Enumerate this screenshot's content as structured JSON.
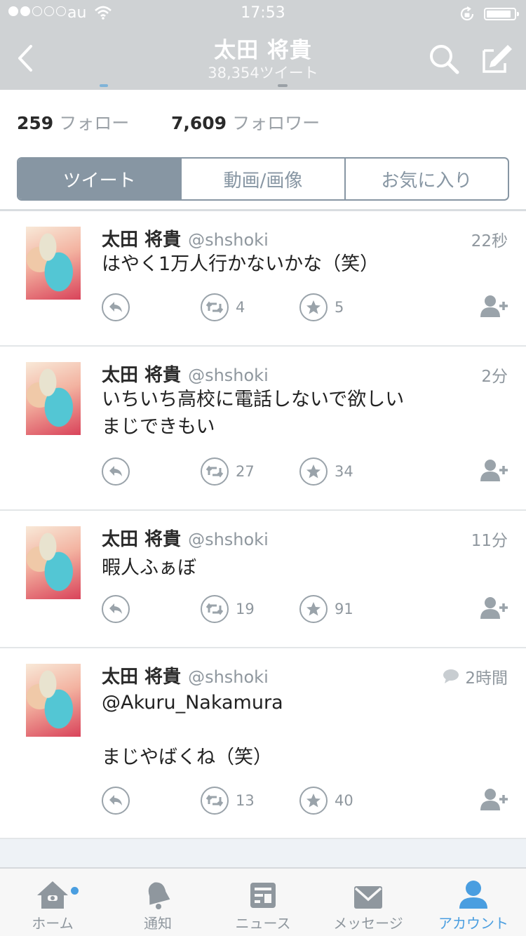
{
  "status_bar": {
    "carrier": "au",
    "time": "17:53"
  },
  "nav": {
    "title": "太田 将貴",
    "subtitle": "38,354ツイート"
  },
  "stats": {
    "following_count": "259",
    "following_label": "フォロー",
    "followers_count": "7,609",
    "followers_label": "フォロワー"
  },
  "segments": [
    "ツイート",
    "動画/画像",
    "お気に入り"
  ],
  "tweets": [
    {
      "name": "太田 将貴",
      "handle": "@shshoki",
      "time": "22秒",
      "text": "はやく1万人行かないかな（笑）",
      "retweets": "4",
      "favorites": "5",
      "has_reply_icon": false
    },
    {
      "name": "太田 将貴",
      "handle": "@shshoki",
      "time": "2分",
      "text": "いちいち高校に電話しないで欲しい\nまじできもい",
      "retweets": "27",
      "favorites": "34",
      "has_reply_icon": false
    },
    {
      "name": "太田 将貴",
      "handle": "@shshoki",
      "time": "11分",
      "text": "暇人ふぁぼ",
      "retweets": "19",
      "favorites": "91",
      "has_reply_icon": false
    },
    {
      "name": "太田 将貴",
      "handle": "@shshoki",
      "time": "2時間",
      "text": "@Akuru_Nakamura\n\nまじやばくね（笑）",
      "retweets": "13",
      "favorites": "40",
      "has_reply_icon": true
    }
  ],
  "tabs": [
    {
      "label": "ホーム",
      "icon": "home-icon",
      "active": false
    },
    {
      "label": "通知",
      "icon": "bell-icon",
      "active": false
    },
    {
      "label": "ニュース",
      "icon": "news-icon",
      "active": false
    },
    {
      "label": "メッセージ",
      "icon": "envelope-icon",
      "active": false
    },
    {
      "label": "アカウント",
      "icon": "person-icon",
      "active": true
    }
  ],
  "colors": {
    "nav_bar": "#cfd2d4",
    "segment": "#8796a3",
    "accent": "#4a9ee0"
  }
}
